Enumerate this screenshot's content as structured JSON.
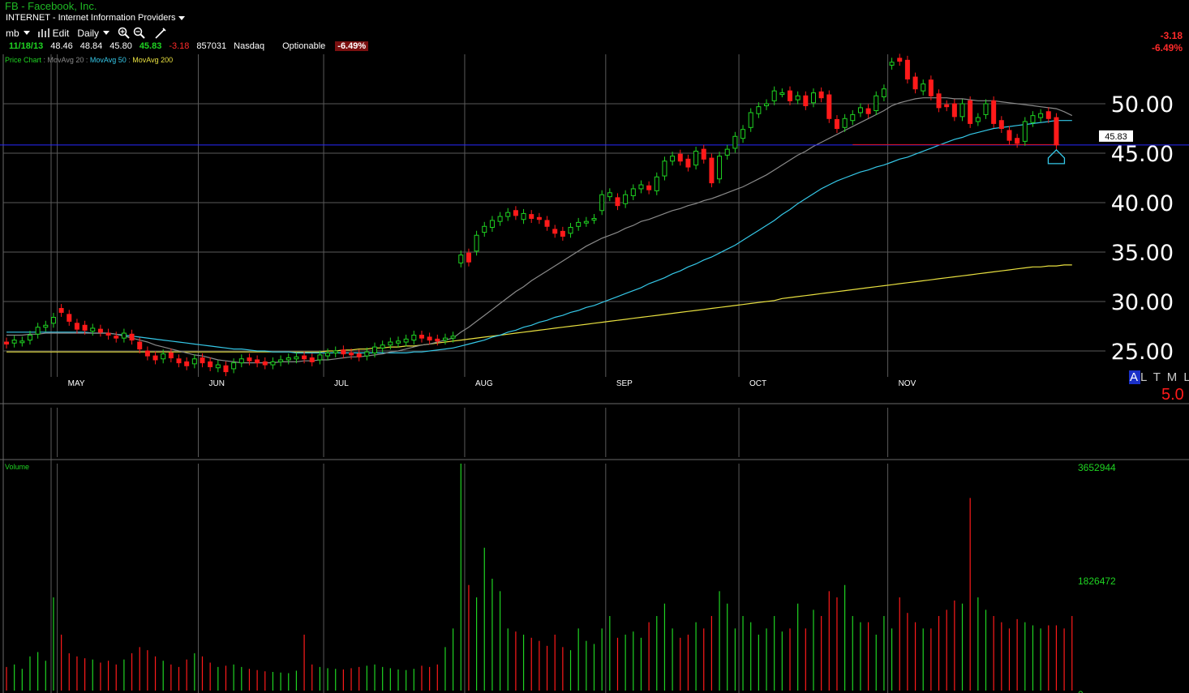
{
  "header": {
    "title": "FB - Facebook, Inc.",
    "sector": "INTERNET - Internet Information Providers"
  },
  "toolbar": {
    "symbol_menu": "mb",
    "edit_label": "Edit",
    "period_label": "Daily"
  },
  "quote": {
    "date": "11/18/13",
    "open": "48.46",
    "high": "48.84",
    "low": "45.80",
    "close": "45.83",
    "change": "-3.18",
    "volume": "857031",
    "exchange": "Nasdaq",
    "optionable": "Optionable",
    "change_pct": "-6.49%"
  },
  "legend": {
    "price_chart": "Price Chart",
    "ma20": "MovAvg 20",
    "ma50": "MovAvg 50",
    "ma200": "MovAvg 200",
    "colors": {
      "price": "#1fd422",
      "ma20": "#8a8a8a",
      "ma50": "#35c8e8",
      "ma200": "#e8e040"
    }
  },
  "right_panel": {
    "change": "-3.18",
    "change_pct": "-6.49%",
    "altml_first": "A",
    "altml_rest": "L T M L",
    "five": "5.0"
  },
  "volume_label": "Volume",
  "colors": {
    "up": "#1fd422",
    "down": "#ff1a1a",
    "grid": "#5a5a5a",
    "last_line": "#2828ff",
    "support_line": "#e01010"
  },
  "chart_data": [
    {
      "type": "candlestick",
      "title": "FB - Facebook, Inc.",
      "ylim": [
        22.5,
        55
      ],
      "y_ticks": [
        "25.00",
        "30.00",
        "35.00",
        "40.00",
        "45.00",
        "50.00"
      ],
      "month_labels": [
        "MAY",
        "JUN",
        "JUL",
        "AUG",
        "SEP",
        "OCT",
        "NOV"
      ],
      "month_start_index": [
        7,
        25,
        41,
        59,
        77,
        94,
        113
      ],
      "last_price_label": "45.83",
      "last_price": 45.83,
      "support_level": 45.0,
      "closes": [
        25.7,
        26.1,
        26.0,
        26.6,
        27.4,
        27.6,
        28.4,
        28.9,
        28.0,
        27.2,
        27.1,
        27.3,
        26.9,
        26.6,
        26.3,
        26.8,
        26.1,
        25.2,
        24.5,
        24.1,
        24.7,
        24.3,
        23.8,
        23.5,
        24.2,
        23.8,
        23.4,
        23.6,
        22.9,
        23.8,
        24.2,
        24.0,
        23.8,
        23.6,
        23.9,
        24.1,
        24.3,
        24.4,
        24.2,
        23.9,
        24.6,
        24.8,
        25.0,
        24.7,
        24.6,
        24.4,
        24.9,
        25.4,
        25.6,
        25.9,
        26.0,
        26.2,
        26.6,
        26.3,
        26.1,
        26.0,
        26.3,
        26.5,
        34.7,
        34.0,
        36.7,
        37.6,
        38.2,
        38.6,
        39.0,
        38.7,
        38.9,
        38.4,
        38.3,
        37.6,
        36.9,
        36.6,
        37.5,
        38.0,
        38.1,
        38.4,
        40.8,
        41.0,
        39.7,
        40.8,
        41.4,
        41.8,
        41.3,
        42.6,
        44.2,
        44.7,
        44.2,
        43.6,
        45.2,
        44.4,
        42.0,
        44.7,
        45.4,
        46.7,
        47.4,
        49.1,
        49.7,
        50.0,
        51.3,
        51.1,
        50.3,
        50.8,
        49.8,
        51.1,
        50.6,
        48.5,
        47.5,
        48.5,
        48.9,
        49.6,
        49.0,
        50.8,
        51.5,
        54.2,
        54.3,
        52.5,
        51.5,
        52.0,
        50.8,
        49.6,
        49.7,
        48.7,
        50.0,
        48.0,
        48.6,
        50.0,
        48.0,
        47.5,
        46.3,
        46.0,
        48.2,
        48.8,
        49.0,
        48.5,
        45.83
      ],
      "opens": [
        25.9,
        25.8,
        25.9,
        26.1,
        26.7,
        27.4,
        27.8,
        29.3,
        28.7,
        27.8,
        27.6,
        27.0,
        27.2,
        26.8,
        26.5,
        26.3,
        26.7,
        25.9,
        25.0,
        24.5,
        24.2,
        24.8,
        24.2,
        23.9,
        23.7,
        24.3,
        23.9,
        23.3,
        23.5,
        23.2,
        23.8,
        24.3,
        24.1,
        23.9,
        23.6,
        23.9,
        24.1,
        24.2,
        24.5,
        24.3,
        24.1,
        24.5,
        24.8,
        25.1,
        24.8,
        24.7,
        24.5,
        24.8,
        25.3,
        25.6,
        25.8,
        25.9,
        26.1,
        26.6,
        26.4,
        26.2,
        26.1,
        26.3,
        33.9,
        34.9,
        35.1,
        37.0,
        37.5,
        38.1,
        38.6,
        39.2,
        38.3,
        38.8,
        38.5,
        38.2,
        37.3,
        37.1,
        36.9,
        37.6,
        38.0,
        38.3,
        39.2,
        40.6,
        40.5,
        39.9,
        40.7,
        41.4,
        41.7,
        41.2,
        42.7,
        44.2,
        44.9,
        44.4,
        43.8,
        45.4,
        44.5,
        42.4,
        44.8,
        45.5,
        46.5,
        47.6,
        49.0,
        49.8,
        50.3,
        51.1,
        51.3,
        50.4,
        50.8,
        50.1,
        51.2,
        50.9,
        48.4,
        47.6,
        48.3,
        49.1,
        49.5,
        49.3,
        50.7,
        53.9,
        54.6,
        54.4,
        52.7,
        51.3,
        52.4,
        51.0,
        49.9,
        50.0,
        48.7,
        50.3,
        48.2,
        48.9,
        50.3,
        48.3,
        47.3,
        46.5,
        46.2,
        48.1,
        48.6,
        49.2,
        48.6
      ],
      "ma20": [
        26.6,
        26.6,
        26.6,
        26.7,
        26.7,
        26.8,
        26.8,
        26.8,
        26.8,
        26.8,
        26.8,
        26.8,
        26.8,
        26.8,
        26.7,
        26.5,
        26.3,
        26.1,
        25.9,
        25.6,
        25.4,
        25.2,
        25.0,
        24.8,
        24.6,
        24.5,
        24.3,
        24.1,
        24.0,
        23.9,
        23.8,
        23.8,
        23.8,
        23.8,
        23.8,
        23.9,
        23.9,
        23.9,
        24.0,
        24.0,
        24.1,
        24.1,
        24.2,
        24.3,
        24.4,
        24.4,
        24.5,
        24.6,
        24.7,
        24.9,
        25.0,
        25.2,
        25.4,
        25.6,
        25.7,
        25.9,
        26.1,
        26.3,
        26.9,
        27.4,
        28.0,
        28.6,
        29.2,
        29.8,
        30.4,
        31.0,
        31.5,
        32.1,
        32.6,
        33.1,
        33.6,
        34.1,
        34.6,
        35.1,
        35.6,
        36.0,
        36.4,
        36.7,
        37.0,
        37.4,
        37.7,
        38.1,
        38.3,
        38.6,
        38.9,
        39.2,
        39.4,
        39.7,
        39.9,
        40.2,
        40.4,
        40.7,
        41.0,
        41.3,
        41.6,
        42.0,
        42.4,
        42.8,
        43.3,
        43.8,
        44.3,
        44.8,
        45.2,
        45.7,
        46.1,
        46.5,
        46.9,
        47.3,
        47.7,
        48.1,
        48.5,
        48.9,
        49.3,
        49.8,
        50.1,
        50.3,
        50.5,
        50.6,
        50.6,
        50.6,
        50.6,
        50.5,
        50.5,
        50.4,
        50.3,
        50.3,
        50.3,
        50.2,
        50.1,
        50.0,
        49.9,
        49.8,
        49.7,
        49.6,
        49.5,
        49.2,
        48.8
      ],
      "ma50": [
        26.9,
        26.9,
        26.9,
        26.9,
        26.9,
        26.9,
        26.9,
        26.9,
        26.9,
        26.9,
        26.9,
        26.8,
        26.8,
        26.8,
        26.7,
        26.6,
        26.5,
        26.4,
        26.3,
        26.2,
        26.1,
        26.0,
        25.9,
        25.8,
        25.7,
        25.6,
        25.5,
        25.4,
        25.3,
        25.2,
        25.2,
        25.1,
        25.0,
        25.0,
        24.9,
        24.9,
        24.9,
        24.8,
        24.8,
        24.8,
        24.8,
        24.8,
        24.8,
        24.8,
        24.8,
        24.8,
        24.8,
        24.8,
        24.8,
        24.8,
        24.8,
        24.8,
        24.9,
        24.9,
        25.0,
        25.1,
        25.2,
        25.3,
        25.5,
        25.7,
        25.9,
        26.1,
        26.4,
        26.6,
        26.9,
        27.1,
        27.4,
        27.6,
        27.9,
        28.1,
        28.4,
        28.6,
        28.9,
        29.1,
        29.4,
        29.6,
        29.9,
        30.2,
        30.5,
        30.8,
        31.1,
        31.4,
        31.8,
        32.1,
        32.4,
        32.8,
        33.1,
        33.5,
        33.8,
        34.2,
        34.5,
        34.9,
        35.3,
        35.7,
        36.2,
        36.7,
        37.2,
        37.7,
        38.2,
        38.8,
        39.3,
        39.9,
        40.4,
        40.9,
        41.4,
        41.8,
        42.2,
        42.5,
        42.8,
        43.1,
        43.3,
        43.6,
        43.8,
        44.1,
        44.4,
        44.6,
        44.9,
        45.2,
        45.5,
        45.8,
        46.1,
        46.4,
        46.6,
        46.9,
        47.1,
        47.3,
        47.5,
        47.6,
        47.7,
        47.8,
        47.9,
        48.0,
        48.1,
        48.2,
        48.3,
        48.3,
        48.3
      ],
      "ma200": [
        24.9,
        24.9,
        24.9,
        24.9,
        24.9,
        24.9,
        24.9,
        24.9,
        24.9,
        24.9,
        24.9,
        24.9,
        24.9,
        24.9,
        24.9,
        24.9,
        24.9,
        24.9,
        24.9,
        24.9,
        24.9,
        24.9,
        24.9,
        24.9,
        24.9,
        24.9,
        24.9,
        24.9,
        24.9,
        24.9,
        24.9,
        24.9,
        24.9,
        24.9,
        24.9,
        24.9,
        24.9,
        24.9,
        24.9,
        24.9,
        24.9,
        25.0,
        25.0,
        25.1,
        25.1,
        25.2,
        25.2,
        25.3,
        25.3,
        25.4,
        25.4,
        25.5,
        25.5,
        25.6,
        25.7,
        25.8,
        25.9,
        26.0,
        26.1,
        26.2,
        26.3,
        26.4,
        26.5,
        26.6,
        26.7,
        26.8,
        26.9,
        27.0,
        27.1,
        27.2,
        27.3,
        27.4,
        27.5,
        27.6,
        27.7,
        27.8,
        27.9,
        28.0,
        28.1,
        28.2,
        28.3,
        28.4,
        28.5,
        28.6,
        28.7,
        28.8,
        28.9,
        29.0,
        29.1,
        29.2,
        29.3,
        29.4,
        29.5,
        29.6,
        29.7,
        29.8,
        29.9,
        30.0,
        30.1,
        30.3,
        30.4,
        30.5,
        30.6,
        30.7,
        30.8,
        30.9,
        31.0,
        31.1,
        31.2,
        31.3,
        31.4,
        31.5,
        31.6,
        31.7,
        31.8,
        31.9,
        32.0,
        32.1,
        32.2,
        32.3,
        32.4,
        32.5,
        32.6,
        32.7,
        32.8,
        32.9,
        33.0,
        33.1,
        33.2,
        33.3,
        33.4,
        33.5,
        33.5,
        33.6,
        33.6,
        33.7,
        33.7
      ]
    },
    {
      "type": "bar",
      "title": "Volume",
      "y_ticks": [
        "0",
        "1826472",
        "3652944"
      ],
      "ylim": [
        0,
        3652944
      ],
      "values": [
        380000,
        420000,
        350000,
        550000,
        620000,
        480000,
        1500000,
        900000,
        600000,
        550000,
        520000,
        500000,
        450000,
        480000,
        420000,
        500000,
        600000,
        700000,
        650000,
        550000,
        480000,
        420000,
        380000,
        500000,
        600000,
        550000,
        450000,
        380000,
        400000,
        420000,
        380000,
        350000,
        330000,
        310000,
        300000,
        290000,
        280000,
        320000,
        900000,
        420000,
        380000,
        360000,
        350000,
        340000,
        360000,
        380000,
        400000,
        420000,
        380000,
        360000,
        340000,
        330000,
        350000,
        400000,
        380000,
        420000,
        700000,
        1000000,
        3652944,
        1700000,
        1500000,
        2300000,
        1800000,
        1600000,
        1000000,
        950000,
        900000,
        850000,
        800000,
        720000,
        900000,
        700000,
        650000,
        1000000,
        800000,
        750000,
        1000000,
        1200000,
        850000,
        900000,
        950000,
        850000,
        1100000,
        1200000,
        1400000,
        1000000,
        850000,
        900000,
        1100000,
        1000000,
        1200000,
        1600000,
        1400000,
        1000000,
        1200000,
        1100000,
        900000,
        1000000,
        1200000,
        950000,
        1000000,
        1400000,
        1000000,
        1300000,
        1200000,
        1600000,
        1500000,
        1700000,
        1200000,
        1100000,
        1100000,
        900000,
        1200000,
        1000000,
        1500000,
        1250000,
        1100000,
        1000000,
        1000000,
        1200000,
        1300000,
        1450000,
        1400000,
        3100000,
        1500000,
        1300000,
        1200000,
        1100000,
        1000000,
        1150000,
        1100000,
        1050000,
        1000000,
        1050000,
        1050000,
        1000000,
        1200000
      ]
    }
  ]
}
